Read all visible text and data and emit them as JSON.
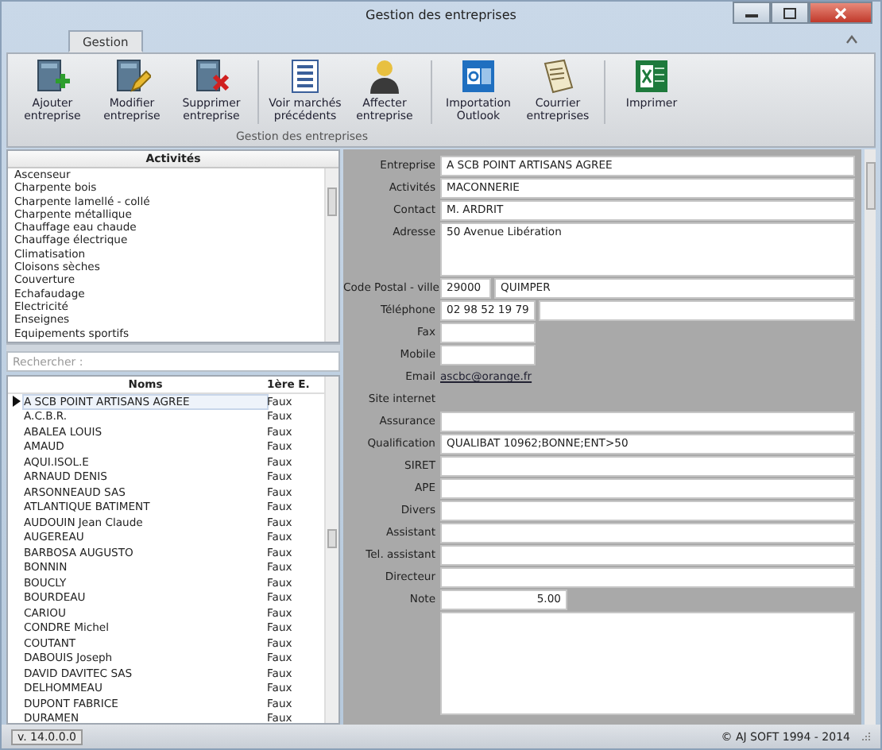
{
  "window": {
    "title": "Gestion des entreprises"
  },
  "tabs": [
    {
      "label": "Gestion",
      "selected": true
    }
  ],
  "ribbon": {
    "group_label": "Gestion des entreprises",
    "sections": [
      {
        "buttons": [
          {
            "label": "Ajouter entreprise",
            "kind": "add"
          },
          {
            "label": "Modifier entreprise",
            "kind": "edit"
          },
          {
            "label": "Supprimer entreprise",
            "kind": "delete"
          }
        ]
      },
      {
        "buttons": [
          {
            "label": "Voir marchés précédents",
            "kind": "list"
          },
          {
            "label": "Affecter entreprise",
            "kind": "person"
          }
        ]
      },
      {
        "buttons": [
          {
            "label": "Importation Outlook",
            "kind": "outlook"
          },
          {
            "label": "Courrier entreprises",
            "kind": "mail"
          }
        ]
      },
      {
        "buttons": [
          {
            "label": "Imprimer",
            "kind": "excel"
          }
        ]
      }
    ]
  },
  "activities": {
    "title": "Activités",
    "items": [
      "Ascenseur",
      "Charpente bois",
      "Charpente lamellé - collé",
      "Charpente métallique",
      "Chauffage eau chaude",
      "Chauffage électrique",
      "Climatisation",
      "Cloisons sèches",
      "Couverture",
      "Echafaudage",
      "Electricité",
      "Enseignes",
      "Equipements sportifs"
    ]
  },
  "search": {
    "placeholder": "Rechercher :"
  },
  "grid": {
    "columns": [
      "Noms",
      "1ère E."
    ],
    "rows": [
      {
        "name": "A SCB POINT ARTISANS AGREE",
        "value": "Faux",
        "selected": true
      },
      {
        "name": "A.C.B.R.",
        "value": "Faux",
        "selected": false
      },
      {
        "name": "ABALEA LOUIS",
        "value": "Faux",
        "selected": false
      },
      {
        "name": "AMAUD",
        "value": "Faux",
        "selected": false
      },
      {
        "name": "AQUI.ISOL.E",
        "value": "Faux",
        "selected": false
      },
      {
        "name": "ARNAUD DENIS",
        "value": "Faux",
        "selected": false
      },
      {
        "name": "ARSONNEAUD SAS",
        "value": "Faux",
        "selected": false
      },
      {
        "name": "ATLANTIQUE BATIMENT",
        "value": "Faux",
        "selected": false
      },
      {
        "name": "AUDOUIN Jean Claude",
        "value": "Faux",
        "selected": false
      },
      {
        "name": "AUGEREAU",
        "value": "Faux",
        "selected": false
      },
      {
        "name": "BARBOSA AUGUSTO",
        "value": "Faux",
        "selected": false
      },
      {
        "name": "BONNIN",
        "value": "Faux",
        "selected": false
      },
      {
        "name": "BOUCLY",
        "value": "Faux",
        "selected": false
      },
      {
        "name": "BOURDEAU",
        "value": "Faux",
        "selected": false
      },
      {
        "name": "CARIOU",
        "value": "Faux",
        "selected": false
      },
      {
        "name": "CONDRE Michel",
        "value": "Faux",
        "selected": false
      },
      {
        "name": "COUTANT",
        "value": "Faux",
        "selected": false
      },
      {
        "name": "DABOUIS Joseph",
        "value": "Faux",
        "selected": false
      },
      {
        "name": "DAVID DAVITEC SAS",
        "value": "Faux",
        "selected": false
      },
      {
        "name": "DELHOMMEAU",
        "value": "Faux",
        "selected": false
      },
      {
        "name": "DUPONT FABRICE",
        "value": "Faux",
        "selected": false
      },
      {
        "name": "DURAMEN",
        "value": "Faux",
        "selected": false
      }
    ]
  },
  "form": [
    {
      "label": "Entreprise",
      "kind": "text",
      "value": "A SCB POINT ARTISANS AGREE"
    },
    {
      "label": "Activités",
      "kind": "text",
      "value": "MACONNERIE"
    },
    {
      "label": "Contact",
      "kind": "text",
      "value": "M. ARDRIT"
    },
    {
      "label": "Adresse",
      "kind": "textarea",
      "value": "50 Avenue Libération"
    },
    {
      "label": "Code Postal - ville",
      "kind": "pair",
      "value": "29000",
      "value2": "QUIMPER"
    },
    {
      "label": "Téléphone",
      "kind": "phone",
      "value": "02 98 52 19 79"
    },
    {
      "label": "Fax",
      "kind": "short"
    },
    {
      "label": "Mobile",
      "kind": "short"
    },
    {
      "label": "Email",
      "kind": "link",
      "value": "ascbc@orange.fr"
    },
    {
      "label": "Site internet",
      "kind": "plain"
    },
    {
      "label": "Assurance",
      "kind": "text"
    },
    {
      "label": "Qualification",
      "kind": "text",
      "value": "QUALIBAT 10962;BONNE;ENT>50"
    },
    {
      "label": "SIRET",
      "kind": "text"
    },
    {
      "label": "APE",
      "kind": "text"
    },
    {
      "label": "Divers",
      "kind": "text"
    },
    {
      "label": "Assistant",
      "kind": "text"
    },
    {
      "label": "Tel. assistant",
      "kind": "text"
    },
    {
      "label": "Directeur",
      "kind": "text"
    },
    {
      "label": "Note",
      "kind": "note",
      "value": "5.00"
    }
  ],
  "status_bar": {
    "version": "v. 14.0.0.0",
    "copyright": "© AJ SOFT 1994 - 2014"
  }
}
